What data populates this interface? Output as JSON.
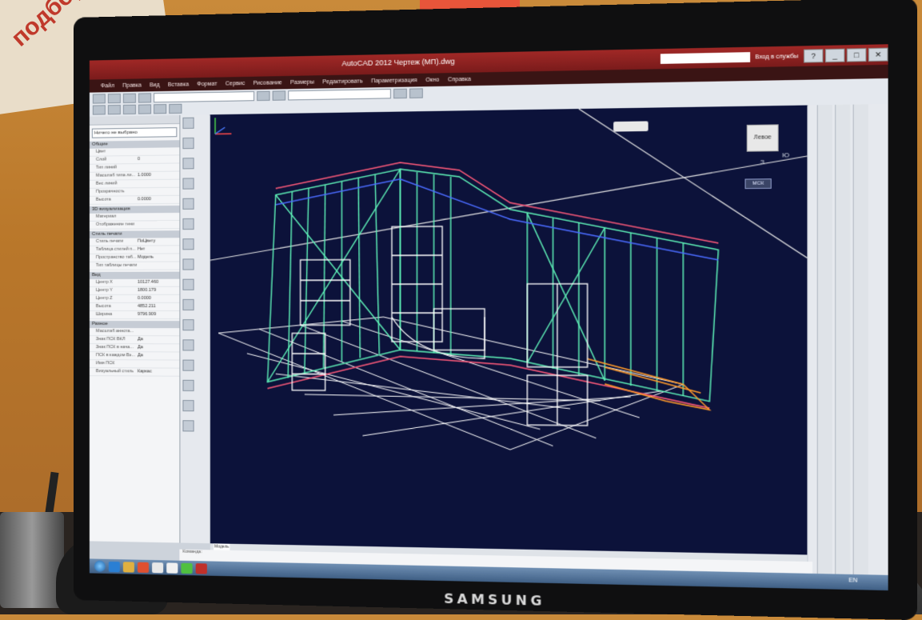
{
  "background": {
    "sign_text": "подбор",
    "monitor_brand": "SAMSUNG"
  },
  "window": {
    "title": "AutoCAD 2012   Чертеж (МП).dwg",
    "search_placeholder": "",
    "signin_label": "Вход в службы",
    "min_label": "_",
    "max_label": "□",
    "close_label": "✕",
    "help_label": "?"
  },
  "menubar": {
    "items": [
      "Файл",
      "Правка",
      "Вид",
      "Вставка",
      "Формат",
      "Сервис",
      "Рисование",
      "Размеры",
      "Редактировать",
      "Параметризация",
      "Окно",
      "Справка"
    ]
  },
  "toolbar": {
    "workspace": "",
    "layer": ""
  },
  "properties": {
    "selector": "Ничего не выбрано",
    "sections": [
      {
        "name": "Общие",
        "rows": [
          {
            "k": "Цвет",
            "v": ""
          },
          {
            "k": "Слой",
            "v": "0"
          },
          {
            "k": "Тип линий",
            "v": ""
          },
          {
            "k": "Масштаб типа ли...",
            "v": "1.0000"
          },
          {
            "k": "Вес линий",
            "v": ""
          },
          {
            "k": "Прозрачность",
            "v": ""
          },
          {
            "k": "Высота",
            "v": "0.0000"
          }
        ]
      },
      {
        "name": "3D визуализация",
        "rows": [
          {
            "k": "Материал",
            "v": ""
          },
          {
            "k": "Отображение тени",
            "v": ""
          }
        ]
      },
      {
        "name": "Стиль печати",
        "rows": [
          {
            "k": "Стиль печати",
            "v": "ПоЦвету"
          },
          {
            "k": "Таблица стилей п...",
            "v": "Нет"
          },
          {
            "k": "Пространство таб...",
            "v": "Модель"
          },
          {
            "k": "Тип таблицы печати",
            "v": ""
          }
        ]
      },
      {
        "name": "Вид",
        "rows": [
          {
            "k": "Центр X",
            "v": "10127.460"
          },
          {
            "k": "Центр Y",
            "v": "1800.179"
          },
          {
            "k": "Центр Z",
            "v": "0.0000"
          },
          {
            "k": "Высота",
            "v": "4852.211"
          },
          {
            "k": "Ширина",
            "v": "9796.909"
          }
        ]
      },
      {
        "name": "Разное",
        "rows": [
          {
            "k": "Масштаб аннота...",
            "v": ""
          },
          {
            "k": "Знак ПСК ВКЛ",
            "v": "Да"
          },
          {
            "k": "Знак ПСК в нача...",
            "v": "Да"
          },
          {
            "k": "ПСК в каждом Вэ...",
            "v": "Да"
          },
          {
            "k": "Имя ПСК",
            "v": ""
          },
          {
            "k": "Визуальный стиль",
            "v": "Каркас"
          }
        ]
      }
    ]
  },
  "viewport": {
    "viewcube_face": "Левое",
    "compass_e": "В",
    "compass_s": "Ю",
    "compass_w": "З",
    "wcs_label": "МСК"
  },
  "bottom": {
    "model_tab": "Модель",
    "command_line_1": "Команда:",
    "command_line_2": ""
  },
  "taskbar": {
    "language": "EN"
  }
}
